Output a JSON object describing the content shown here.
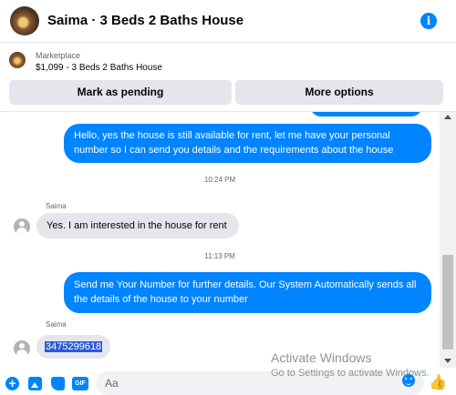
{
  "header": {
    "title": "Saima · 3 Beds 2 Baths House",
    "info_icon": "info-icon"
  },
  "listing": {
    "source": "Marketplace",
    "description": "$1,099 - 3 Beds 2 Baths House",
    "mark_pending_label": "Mark as pending",
    "more_options_label": "More options"
  },
  "messages": [
    {
      "direction": "outgoing",
      "text": "Hello, yes the house is still available for rent, let me have your personal number so I can send you details and the requirements about the house"
    },
    {
      "type": "timestamp",
      "text": "10:24 PM"
    },
    {
      "direction": "incoming",
      "sender": "Saima",
      "text": "Yes. I am interested in the house for rent"
    },
    {
      "type": "timestamp",
      "text": "11:13 PM"
    },
    {
      "direction": "outgoing",
      "text": "Send me Your Number for further details. Our System Automatically sends all the details of the house to your  number"
    },
    {
      "direction": "incoming",
      "sender": "Saima",
      "text": "3475299618"
    }
  ],
  "composer": {
    "placeholder": "Aa",
    "icons": [
      "plus-icon",
      "image-icon",
      "sticker-icon",
      "gif-icon",
      "emoji-icon",
      "like-icon"
    ],
    "gif_label": "GIF"
  },
  "watermark": {
    "title": "Activate Windows",
    "subtitle": "Go to Settings to activate Windows."
  },
  "colors": {
    "accent": "#0084ff",
    "incoming_bubble": "#e4e6eb",
    "button_bg": "#e4e6eb",
    "selection": "#2c5bd6"
  }
}
